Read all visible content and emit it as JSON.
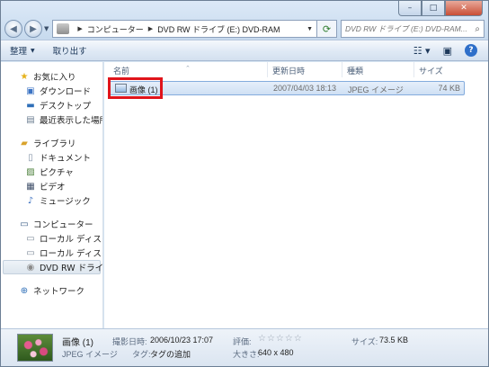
{
  "window": {
    "controls": {
      "minimize": "–",
      "maximize": "□",
      "close": "✕"
    }
  },
  "nav": {
    "back_icon": "back-arrow-icon",
    "forward_icon": "forward-arrow-icon",
    "address": {
      "crumbs": [
        "コンピューター",
        "DVD RW ドライブ (E:) DVD-RAM"
      ]
    },
    "search_placeholder": "DVD RW ドライブ (E:) DVD-RAM..."
  },
  "toolbar": {
    "organize": "整理",
    "eject": "取り出す"
  },
  "sidebar": {
    "favorites": {
      "label": "お気に入り",
      "items": [
        "ダウンロード",
        "デスクトップ",
        "最近表示した場所"
      ]
    },
    "libraries": {
      "label": "ライブラリ",
      "items": [
        "ドキュメント",
        "ピクチャ",
        "ビデオ",
        "ミュージック"
      ]
    },
    "computer": {
      "label": "コンピューター",
      "items": [
        "ローカル ディスク (",
        "ローカル ディスク (",
        "DVD RW ドライブ"
      ]
    },
    "network": {
      "label": "ネットワーク"
    }
  },
  "files": {
    "columns": {
      "name": "名前",
      "modified": "更新日時",
      "type": "種類",
      "size": "サイズ"
    },
    "rows": [
      {
        "name": "画像 (1)",
        "modified": "2007/04/03 18:13",
        "type": "JPEG イメージ",
        "size": "74 KB"
      }
    ]
  },
  "details": {
    "name": "画像 (1)",
    "type": "JPEG イメージ",
    "taken_label": "撮影日時:",
    "taken_value": "2006/10/23 17:07",
    "tags_label": "タグ:",
    "tags_value": "タグの追加",
    "rating_label": "評価:",
    "rating_stars": "☆☆☆☆☆",
    "dimensions_label": "大きさ:",
    "dimensions_value": "640 x 480",
    "size_label": "サイズ:",
    "size_value": "73.5 KB"
  },
  "colors": {
    "highlight": "#e0141b",
    "selection": "#cfe0f4"
  }
}
